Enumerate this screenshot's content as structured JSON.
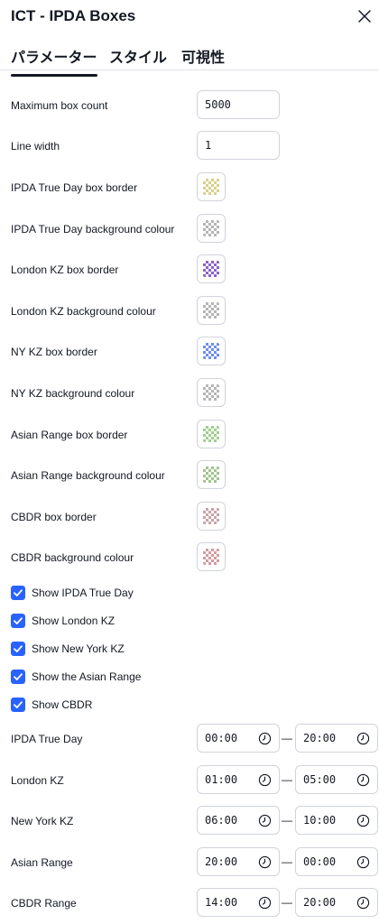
{
  "header": {
    "title": "ICT - IPDA Boxes",
    "close_icon": "close-icon"
  },
  "tabs": [
    {
      "label": "パラメーター",
      "active": true
    },
    {
      "label": "スタイル",
      "active": false
    },
    {
      "label": "可視性",
      "active": false
    }
  ],
  "inputs": {
    "max_box_count": {
      "label": "Maximum box count",
      "value": "5000"
    },
    "line_width": {
      "label": "Line width",
      "value": "1"
    }
  },
  "colors": [
    {
      "label": "IPDA True Day box border",
      "color": "#d9cf8a"
    },
    {
      "label": "IPDA True Day background colour",
      "color": "#b5b5b5"
    },
    {
      "label": "London KZ box border",
      "color": "#8a63c9"
    },
    {
      "label": "London KZ background colour",
      "color": "#b5b5b5"
    },
    {
      "label": "NY KZ box border",
      "color": "#6f8ee8"
    },
    {
      "label": "NY KZ background colour",
      "color": "#b5b5b5"
    },
    {
      "label": "Asian Range box border",
      "color": "#9fcf8f"
    },
    {
      "label": "Asian Range background colour",
      "color": "#9fc48e"
    },
    {
      "label": "CBDR box border",
      "color": "#c9a3a7"
    },
    {
      "label": "CBDR background colour",
      "color": "#d49a9f"
    }
  ],
  "checkboxes": [
    {
      "label": "Show IPDA True Day",
      "checked": true
    },
    {
      "label": "Show London KZ",
      "checked": true
    },
    {
      "label": "Show New York KZ",
      "checked": true
    },
    {
      "label": "Show the Asian Range",
      "checked": true
    },
    {
      "label": "Show CBDR",
      "checked": true
    }
  ],
  "sessions": [
    {
      "label": "IPDA True Day",
      "start": "00:00",
      "end": "20:00"
    },
    {
      "label": "London KZ",
      "start": "01:00",
      "end": "05:00"
    },
    {
      "label": "New York KZ",
      "start": "06:00",
      "end": "10:00"
    },
    {
      "label": "Asian Range",
      "start": "20:00",
      "end": "00:00"
    },
    {
      "label": "CBDR Range",
      "start": "14:00",
      "end": "20:00"
    }
  ],
  "separator": "—",
  "accent_color": "#2962ff"
}
